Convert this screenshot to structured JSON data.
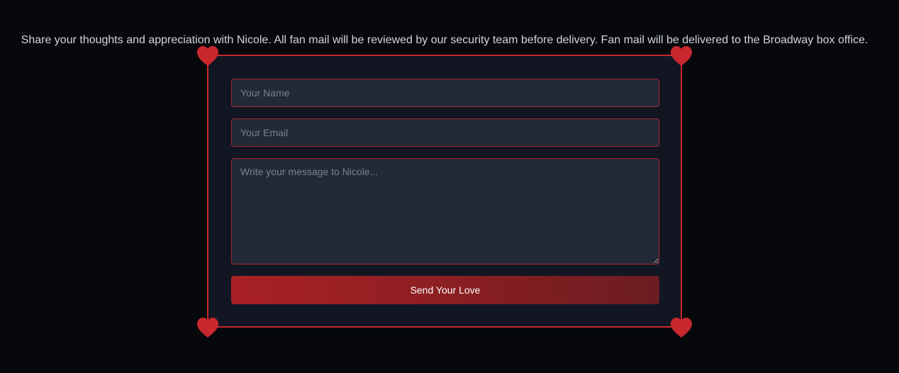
{
  "intro": {
    "text": "Share your thoughts and appreciation with Nicole. All fan mail will be reviewed by our security team before delivery. Fan mail will be delivered to the Broadway box office."
  },
  "form": {
    "name_placeholder": "Your Name",
    "name_value": "",
    "email_placeholder": "Your Email",
    "email_value": "",
    "message_placeholder": "Write your message to Nicole...",
    "message_value": "",
    "submit_label": "Send Your Love"
  },
  "decorations": {
    "corner_icon": "heart-icon",
    "accent_color": "#c8282d"
  },
  "colors": {
    "background": "#07080c",
    "card": "#121623",
    "field": "#222937",
    "accent": "#c8282d"
  }
}
